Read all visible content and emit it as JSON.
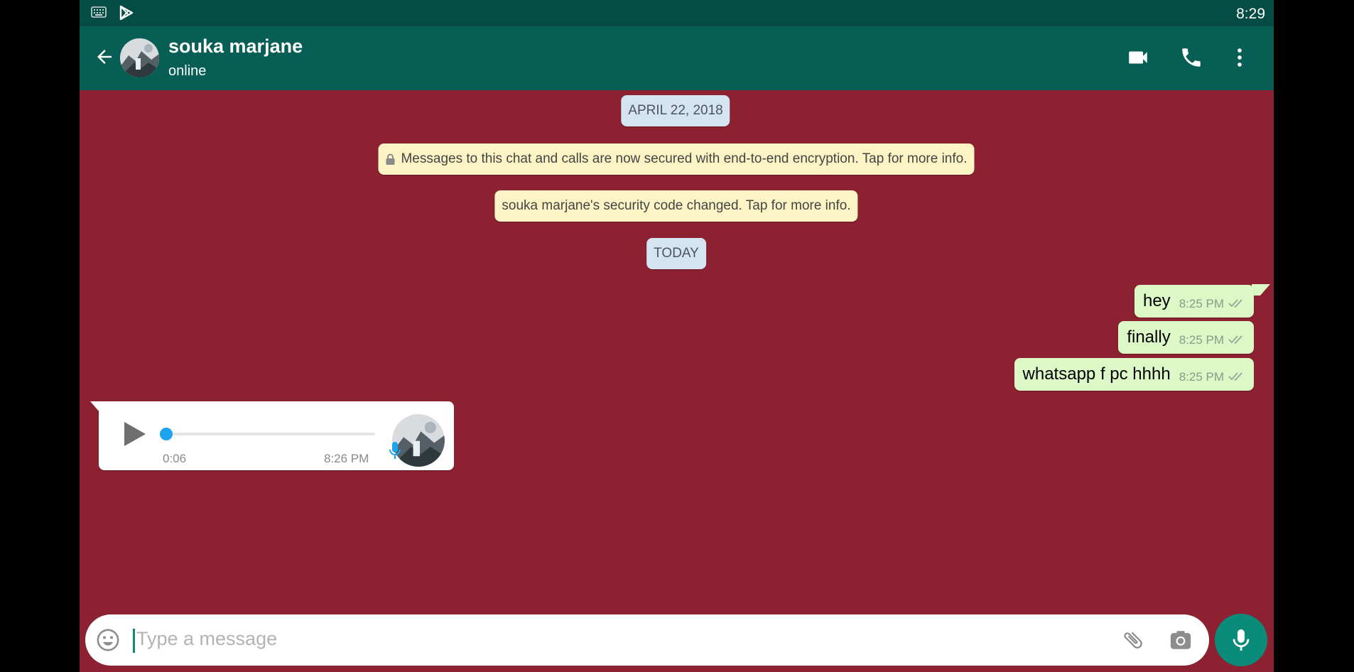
{
  "status_bar": {
    "time": "8:29"
  },
  "header": {
    "contact_name": "souka marjane",
    "presence": "online"
  },
  "chat": {
    "date_april": "APRIL 22, 2018",
    "encryption_notice": "Messages to this chat and calls are now secured with end-to-end encryption. Tap for more info.",
    "security_notice": "souka marjane's security code changed. Tap for more info.",
    "date_today": "TODAY",
    "outgoing": [
      {
        "text": "hey",
        "time": "8:25 PM"
      },
      {
        "text": "finally",
        "time": "8:25 PM"
      },
      {
        "text": "whatsapp f pc hhhh",
        "time": "8:25 PM"
      }
    ],
    "voice_message": {
      "duration": "0:06",
      "time": "8:26 PM",
      "progress": 0
    }
  },
  "composer": {
    "placeholder": "Type a message"
  },
  "colors": {
    "chat_background": "#8b2131",
    "header": "#075e54",
    "status_bar": "#054d44",
    "outgoing_bubble": "#dcf8c6",
    "accent": "#0b8c7a"
  },
  "icons": [
    "keyboard-icon",
    "play-store-icon",
    "back-arrow-icon",
    "video-call-icon",
    "voice-call-icon",
    "more-options-icon",
    "lock-icon",
    "double-check-icon",
    "play-icon",
    "mic-icon",
    "emoji-icon",
    "attach-icon",
    "camera-icon"
  ]
}
